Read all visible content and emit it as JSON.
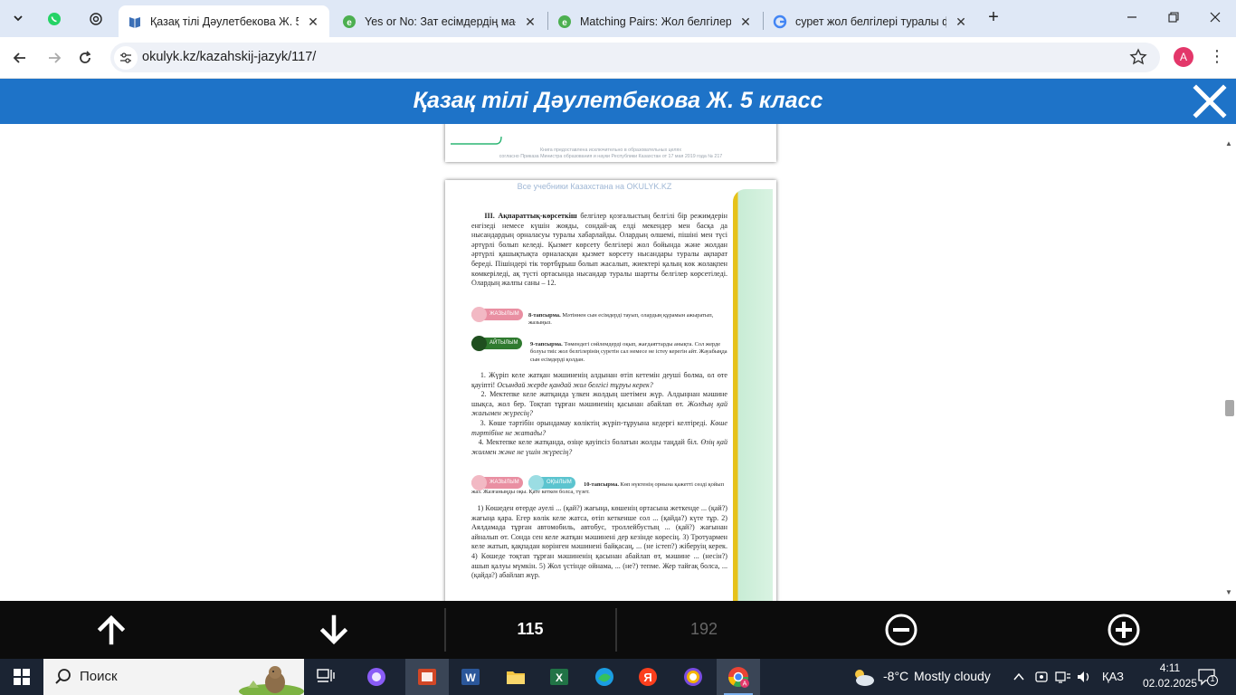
{
  "browser": {
    "tabs": [
      {
        "title": "Қазақ тілі Дәулетбекова Ж. 5 к",
        "active": true,
        "favicon": "book-icon"
      },
      {
        "title": "Yes or No: Зат есімдердің мағы",
        "active": false,
        "favicon": "e-icon"
      },
      {
        "title": "Matching Pairs: Жол белгілерін",
        "active": false,
        "favicon": "e-icon"
      },
      {
        "title": "сурет жол белгілері туралы фо",
        "active": false,
        "favicon": "google-icon"
      }
    ],
    "tab_close": "✕",
    "new_tab": "+",
    "url": "okulyk.kz/kazahskij-jazyk/117/",
    "profile_initial": "A",
    "menu_glyph": "⋮"
  },
  "reader": {
    "title": "Қазақ тілі Дәулетбекова Ж. 5 класс",
    "current_page": "115",
    "total_pages": "192"
  },
  "document": {
    "prev_note_1": "Книга предоставлена исключительно в образовательных целях",
    "prev_note_2": "согласно Приказа Министра образования и науки Республики Казахстан от 17 мая 2019 года № 217",
    "watermark": "Все учебники Казахстана на OKULYK.KZ",
    "para_bold": "ІІІ. Ақпараттық-көрсеткіш",
    "para_text": " белгілер қозғалыстың белгілі бір режимдерін енгізеді немесе күшін жояды, сондай-ақ елді мекендер мен басқа да нысандардың орналасуы туралы хабарлайды. Олардың өлшемі, пішіні мен түсі әртүрлі болып келеді. Қызмет көрсету белгілері жол бойында және жолдан әртүрлі қашықтықта орналасқан қызмет көрсету нысандары туралы ақпарат береді. Пішіндері тік төртбұрыш болып жасалып, жиектері қалың көк жолақпен көмкеріледі, ақ түсті ортасында нысандар туралы шартты белгілер көрсетіледі. Олардың жалпы саны – 12.",
    "badge_write": "ЖАЗЫЛЫМ",
    "badge_speak": "АЙТЫЛЫМ",
    "badge_read": "ОҚЫЛЫМ",
    "task8_bold": "8-тапсырма.",
    "task8_text": " Мәтіннен сын есімдерді тауып, олардың құрамын ажыратып, жазыңыз.",
    "task9_bold": "9-тапсырма.",
    "task9_text": " Төмендегі сөйлемдерді оқып, жағдаяттарды анықта. Сол жерде болуы тиіс жол белгілерінің суретін сал немесе не істеу керегін айт. Жауабыңда сын есімдерді қолдан.",
    "item1": "1. Жүріп келе жатқан мәшиненің алдынан өтіп кетемін деуші болма, ол өте қауіпті!",
    "item1_q": " Осындай жерде қандай жол белгісі тұруы керек?",
    "item2": "2. Мектепке келе жатқанда үлкен жолдың шетімен жүр. Алдыңнан мәшине шықса, жол бер. Тоқтап тұрған мәшиненің қасынан абайлап өт.",
    "item2_q": " Жолдың қай жағымен жүресің?",
    "item3": "3. Көше тәртібін орындамау көліктің жүріп-тұруына кедергі келтіреді.",
    "item3_q": " Көше тәртібіне не жатады?",
    "item4": "4. Мектепке келе жатқанда, өзіңе қауіпсіз болатын жолды таңдай біл.",
    "item4_q": " Өзің қай жолмен және не үшін жүресің?",
    "task10_bold": "10-тапсырма.",
    "task10_text": " Көп нүктенің орнына қажетті сөзді қойып жаз. Жазғаныңды оқы. Қате кеткен болса, түзет.",
    "task10_body": "1) Көшеден өтерде әуелі ... (қай?) жағыңа, көшенің ортасына жеткенде ... (қай?) жағыңа қара. Егер көлік келе жатса, өтіп кеткенше сол ... (қайда?) күте тұр. 2) Аялдамада тұрған автомобиль, автобус, троллейбустың ... (қай?) жағынан айналып өт. Сонда сен келе жатқан мәшинені дер кезінде көресің. 3) Тротуармен келе жатып, қақпадан көрінген мәшинені байқасаң, ... (не істеп?) жіберуің керек. 4) Көшеде тоқтап тұрған мәшиненің қасынан абайлап өт, мәшине ... (несін?) ашып қалуы мүмкін. 5) Жол үстінде ойнама, ... (не?) тепме. Жер тайғақ болса, ... (қайда?) абайлап жүр."
  },
  "taskbar": {
    "search_label": "Поиск",
    "weather_temp": "-8°C",
    "weather_text": "Mostly cloudy",
    "lang": "ҚАЗ",
    "time": "4:11",
    "date": "02.02.2025",
    "notif_count": "1"
  },
  "colors": {
    "reader_blue": "#1e73c8",
    "badge_pink": "#e98fa2",
    "badge_green": "#2f7a2f",
    "badge_teal": "#5cc4cf",
    "page_strip_yellow": "#e6c21a"
  }
}
